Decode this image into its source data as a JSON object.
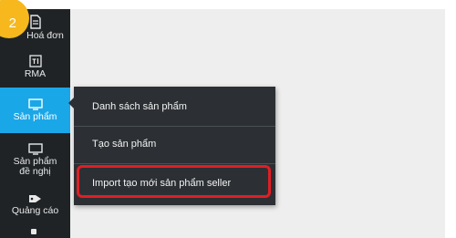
{
  "step_badge": "2",
  "sidebar": {
    "items": [
      {
        "label": "Hoá đơn",
        "icon": "invoice-icon",
        "active": false
      },
      {
        "label": "RMA",
        "icon": "rma-icon",
        "active": false
      },
      {
        "label": "Sản phẩm",
        "icon": "product-monitor-icon",
        "active": true
      },
      {
        "label": "Sản phẩm đề nghị",
        "icon": "suggested-product-monitor-icon",
        "active": false
      },
      {
        "label": "Quảng cáo",
        "icon": "tag-icon",
        "active": false
      }
    ]
  },
  "popup_menu": {
    "items": [
      {
        "label": "Danh sách sản phẩm"
      },
      {
        "label": "Tạo sản phẩm"
      },
      {
        "label": "Import tạo mới sản phẩm seller",
        "highlighted": true
      }
    ]
  },
  "colors": {
    "sidebar_bg": "#1f2326",
    "active_item": "#1aa7e8",
    "popup_bg": "#2c3034",
    "highlight_border": "#e01e24",
    "badge": "#f6b81c",
    "content_bg": "#eeeeee"
  }
}
